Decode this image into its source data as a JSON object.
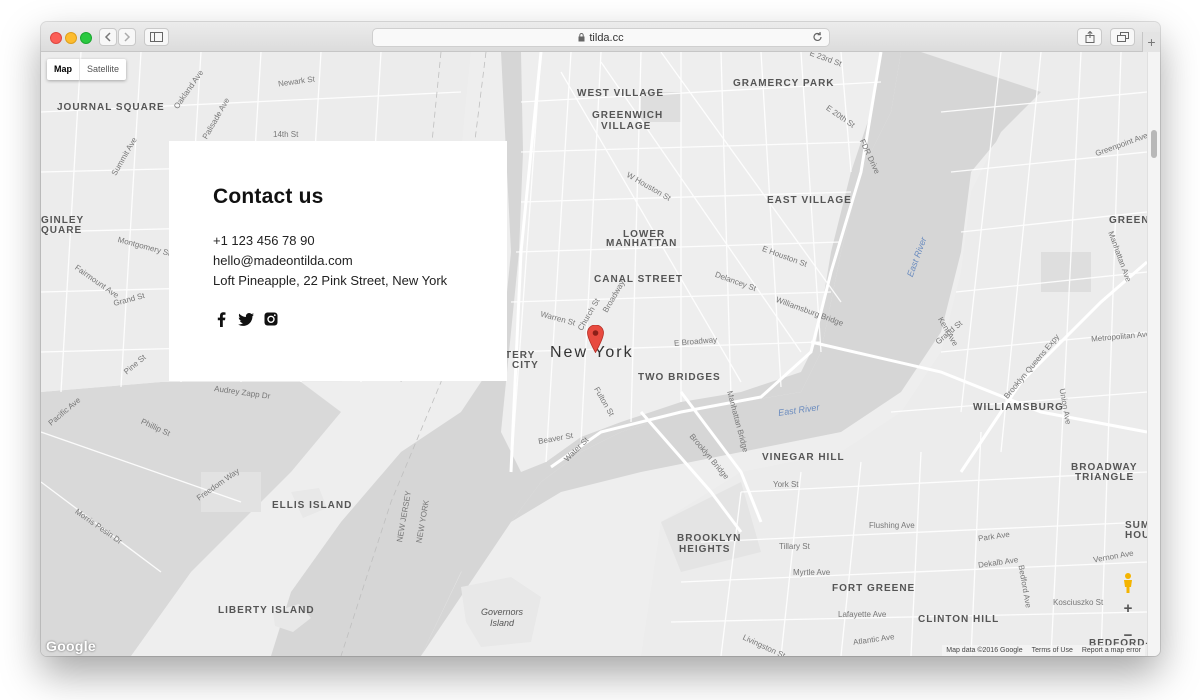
{
  "browser": {
    "url": "tilda.cc"
  },
  "map": {
    "type_control": {
      "map_label": "Map",
      "satellite_label": "Satellite"
    },
    "city_label": "New York",
    "places": [
      {
        "key": "journal",
        "label": "JOURNAL SQUARE"
      },
      {
        "key": "westvillage",
        "label": "WEST VILLAGE"
      },
      {
        "key": "gramercy",
        "label": "GRAMERCY PARK"
      },
      {
        "key": "greenwich1",
        "label": "GREENWICH"
      },
      {
        "key": "greenwich2",
        "label": "VILLAGE"
      },
      {
        "key": "eastvillage",
        "label": "EAST VILLAGE"
      },
      {
        "key": "lower",
        "label": "LOWER"
      },
      {
        "key": "manhattan",
        "label": "MANHATTAN"
      },
      {
        "key": "canal",
        "label": "CANAL STREET"
      },
      {
        "key": "twobridges",
        "label": "TWO BRIDGES"
      },
      {
        "key": "williamsburg",
        "label": "WILLIAMSBURG"
      },
      {
        "key": "vinegar",
        "label": "VINEGAR HILL"
      },
      {
        "key": "ellis",
        "label": "ELLIS ISLAND"
      },
      {
        "key": "liberty",
        "label": "LIBERTY ISLAND"
      },
      {
        "key": "brooklyn1",
        "label": "BROOKLYN"
      },
      {
        "key": "brooklyn2",
        "label": "HEIGHTS"
      },
      {
        "key": "fortgreene",
        "label": "FORT GREENE"
      },
      {
        "key": "clinton",
        "label": "CLINTON HILL"
      },
      {
        "key": "broadway1",
        "label": "BROADWAY"
      },
      {
        "key": "broadway2",
        "label": "TRIANGLE"
      },
      {
        "key": "battery",
        "label": "TERY"
      },
      {
        "key": "battery2",
        "label": "CITY"
      },
      {
        "key": "ginley",
        "label": "GINLEY"
      },
      {
        "key": "quare",
        "label": "QUARE"
      },
      {
        "key": "green",
        "label": "GREENF"
      },
      {
        "key": "sum",
        "label": "SUM"
      },
      {
        "key": "hou",
        "label": "HOU"
      },
      {
        "key": "bedford",
        "label": "BEDFORD-ST"
      }
    ],
    "streets": [
      {
        "key": "s1",
        "label": "Newark St"
      },
      {
        "key": "s2",
        "label": "14th St"
      },
      {
        "key": "s3",
        "label": "Montgomery St"
      },
      {
        "key": "s4",
        "label": "Grand St"
      },
      {
        "key": "s5",
        "label": "Fairmount Ave"
      },
      {
        "key": "s6",
        "label": "Audrey Zapp Dr"
      },
      {
        "key": "s7",
        "label": "Phillip St"
      },
      {
        "key": "s8",
        "label": "Freedom Way"
      },
      {
        "key": "s9",
        "label": "Morris Pesin Dr"
      },
      {
        "key": "s10",
        "label": "Pacific Ave"
      },
      {
        "key": "s11",
        "label": "Pine St"
      },
      {
        "key": "s12",
        "label": "Summit Ave"
      },
      {
        "key": "s13",
        "label": "Palisade Ave"
      },
      {
        "key": "s14",
        "label": "Oakland Ave"
      },
      {
        "key": "s15",
        "label": "E 23rd St"
      },
      {
        "key": "s16",
        "label": "E 20th St"
      },
      {
        "key": "s17",
        "label": "FDR Drive"
      },
      {
        "key": "s18",
        "label": "W Houston St"
      },
      {
        "key": "s19",
        "label": "E Houston St"
      },
      {
        "key": "s20",
        "label": "Delancey St"
      },
      {
        "key": "s21",
        "label": "Williamsburg Bridge"
      },
      {
        "key": "s22",
        "label": "E Broadway"
      },
      {
        "key": "s23",
        "label": "Broadway"
      },
      {
        "key": "s24",
        "label": "Church St"
      },
      {
        "key": "s25",
        "label": "Warren St"
      },
      {
        "key": "s26",
        "label": "Fulton St"
      },
      {
        "key": "s27",
        "label": "Beaver St"
      },
      {
        "key": "s28",
        "label": "Water St"
      },
      {
        "key": "s29",
        "label": "Brooklyn Bridge"
      },
      {
        "key": "s30",
        "label": "Manhattan Bridge"
      },
      {
        "key": "s31",
        "label": "York St"
      },
      {
        "key": "s32",
        "label": "Tillary St"
      },
      {
        "key": "s33",
        "label": "Myrtle Ave"
      },
      {
        "key": "s34",
        "label": "Flushing Ave"
      },
      {
        "key": "s35",
        "label": "Park Ave"
      },
      {
        "key": "s36",
        "label": "Dekalb Ave"
      },
      {
        "key": "s37",
        "label": "Lafayette Ave"
      },
      {
        "key": "s38",
        "label": "Atlantic Ave"
      },
      {
        "key": "s39",
        "label": "Metropolitan Ave"
      },
      {
        "key": "s40",
        "label": "Grand St"
      },
      {
        "key": "s41",
        "label": "Kosciuszko St"
      },
      {
        "key": "s42",
        "label": "Greenpoint Ave"
      },
      {
        "key": "s43",
        "label": "Manhattan Ave"
      },
      {
        "key": "s44",
        "label": "Bedford Ave"
      },
      {
        "key": "s45",
        "label": "Union Ave"
      },
      {
        "key": "s46",
        "label": "Kent Ave"
      },
      {
        "key": "s47",
        "label": "Livingston St"
      },
      {
        "key": "s48",
        "label": "Brooklyn Queens Expy"
      },
      {
        "key": "s49",
        "label": "Vernon Ave"
      }
    ],
    "water_labels": [
      {
        "key": "w1",
        "label": "East River"
      },
      {
        "key": "w2",
        "label": "East River"
      }
    ],
    "state_labels": [
      {
        "key": "nj",
        "label": "NEW JERSEY"
      },
      {
        "key": "ny",
        "label": "NEW YORK"
      },
      {
        "key": "gov1",
        "label": "Governors"
      },
      {
        "key": "gov2",
        "label": "Island"
      }
    ],
    "google_logo": "Google",
    "attribution": {
      "data": "Map data ©2016 Google",
      "terms": "Terms of Use",
      "report": "Report a map error"
    }
  },
  "contact": {
    "title": "Contact us",
    "phone": "+1 123 456 78 90",
    "email": "hello@madeontilda.com",
    "address": "Loft Pineapple, 22 Pink Street, New York"
  },
  "colors": {
    "map_land": "#eeeeee",
    "map_water": "#d6d6d6",
    "map_road": "#ffffff",
    "map_park": "#dcdcdc",
    "pin": "#e84a3f"
  }
}
